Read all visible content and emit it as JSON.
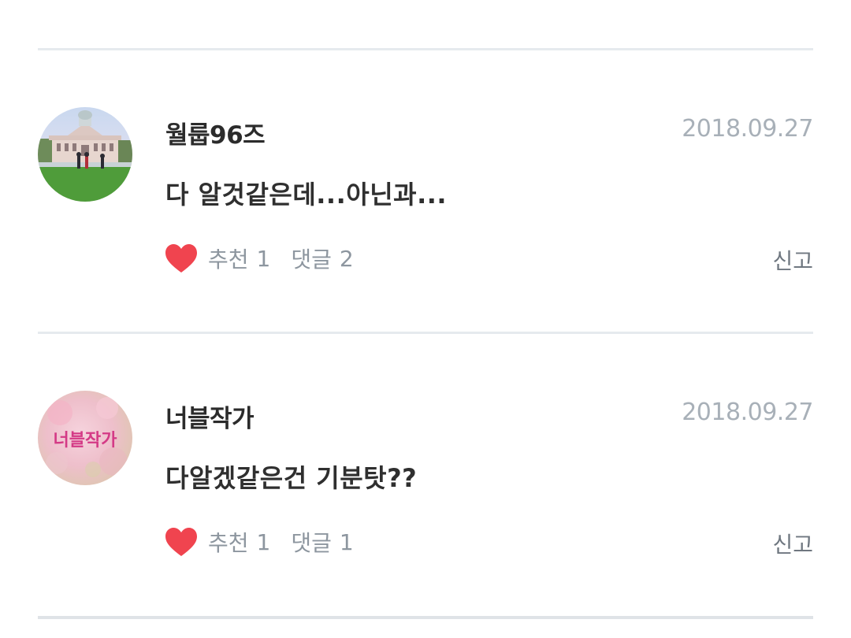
{
  "comments": [
    {
      "username": "월룹96즈",
      "date": "2018.09.27",
      "text": "다 알것같은데...아닌과...",
      "like_label": "추천",
      "like_count": "1",
      "reply_label": "댓글",
      "reply_count": "2",
      "report_label": "신고",
      "avatar_icon": "avatar-photo-building"
    },
    {
      "username": "너블작가",
      "date": "2018.09.27",
      "text": "다알겠같은건 기분탓??",
      "like_label": "추천",
      "like_count": "1",
      "reply_label": "댓글",
      "reply_count": "1",
      "report_label": "신고",
      "avatar_icon": "avatar-pink-logo",
      "avatar_text": "너블작가"
    }
  ],
  "colors": {
    "heart": "#f0444f",
    "divider": "#e6eaee",
    "meta_text": "#8d969f",
    "date_text": "#a8b0b8"
  }
}
